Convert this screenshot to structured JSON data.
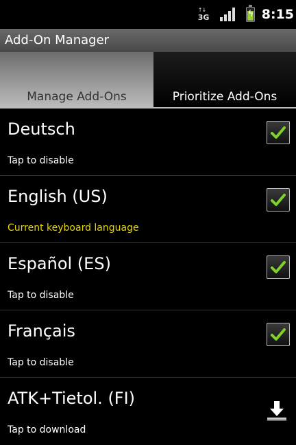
{
  "status_bar": {
    "network_type": "3G",
    "time": "8:15"
  },
  "title_bar": {
    "title": "Add-On Manager"
  },
  "tabs": [
    {
      "label": "Manage Add-Ons",
      "selected": true
    },
    {
      "label": "Prioritize Add-Ons",
      "selected": false
    }
  ],
  "addons": [
    {
      "name": "Deutsch",
      "status": "Tap to disable",
      "action": "checkbox",
      "checked": true
    },
    {
      "name": "English (US)",
      "status": "Current keyboard language",
      "action": "checkbox",
      "checked": true
    },
    {
      "name": "Español (ES)",
      "status": "Tap to disable",
      "action": "checkbox",
      "checked": true
    },
    {
      "name": "Français",
      "status": "Tap to disable",
      "action": "checkbox",
      "checked": true
    },
    {
      "name": "ATK+Tietol. (FI)",
      "status": "Tap to download",
      "action": "download"
    }
  ],
  "colors": {
    "check": "#7FD22A",
    "highlight_status": "#E6D600",
    "background": "#000000"
  },
  "icons": {
    "network": "3g-data-icon",
    "signal": "signal-strength-icon",
    "battery": "battery-charging-icon",
    "checkbox": "checkmark-icon",
    "download": "download-icon"
  }
}
